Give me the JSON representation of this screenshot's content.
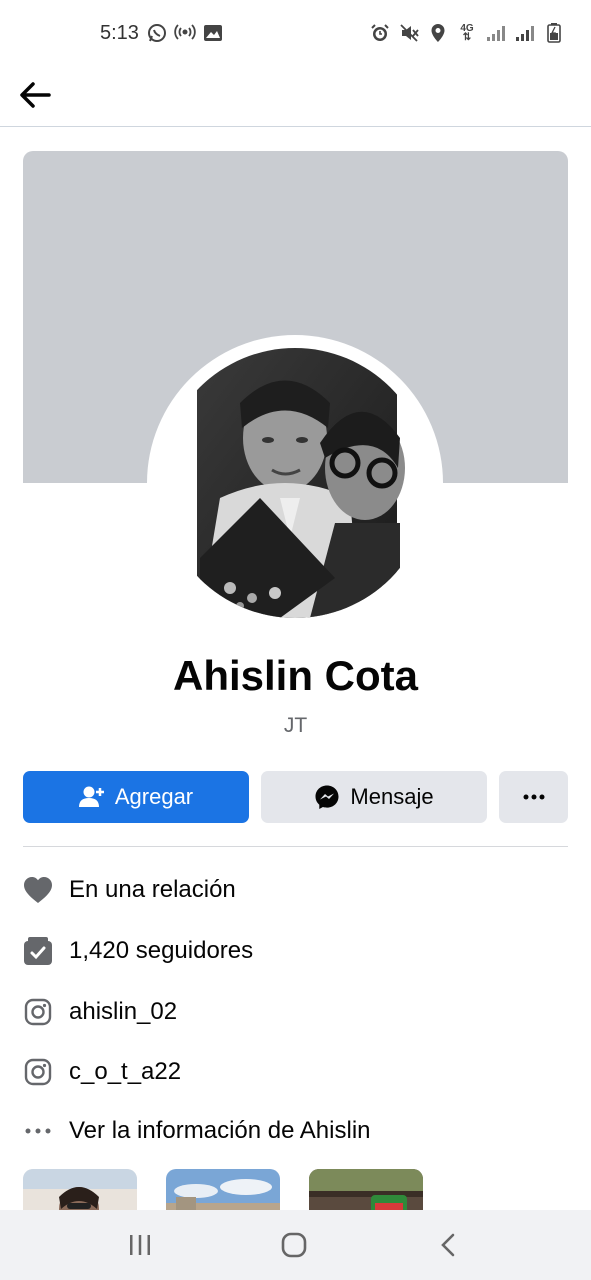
{
  "status_bar": {
    "time": "5:13",
    "left_icons": [
      "whatsapp-icon",
      "hotspot-icon",
      "gallery-icon"
    ],
    "right_icons": [
      "alarm-icon",
      "mute-icon",
      "location-icon",
      "network-4g-icon",
      "signal-icon",
      "signal-icon",
      "battery-icon"
    ],
    "network_label": "4G"
  },
  "app_bar": {
    "back_icon": "arrow-left-icon"
  },
  "profile": {
    "name": "Ahislin Cota",
    "bio": "JT",
    "cover_color": "#c9ccd1"
  },
  "actions": {
    "add_label": "Agregar",
    "message_label": "Mensaje",
    "more_label": "···",
    "accent": "#1b74e4"
  },
  "info": {
    "relationship": "En una relación",
    "followers": "1,420 seguidores",
    "instagram_1": "ahislin_02",
    "instagram_2": "c_o_t_a22",
    "see_info": "Ver la información de Ahislin"
  },
  "nav_bar": {
    "icons": [
      "recent-apps-icon",
      "home-icon",
      "back-icon"
    ]
  }
}
